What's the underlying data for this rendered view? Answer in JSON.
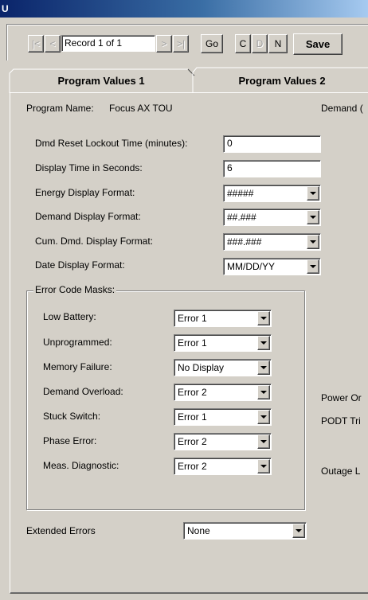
{
  "window": {
    "title_fragment": "U"
  },
  "toolbar": {
    "first_glyph": "|<",
    "prev_glyph": "<",
    "record_text": "Record 1 of 1",
    "next_glyph": ">",
    "last_glyph": ">|",
    "go_label": "Go",
    "c_label": "C",
    "d_label": "D",
    "n_label": "N",
    "save_label": "Save"
  },
  "tabs": [
    {
      "label": "Program Values 1",
      "active": false
    },
    {
      "label": "Program Values 2",
      "active": true
    }
  ],
  "program": {
    "name_label": "Program Name:",
    "name_value": "Focus AX TOU",
    "right_header": "Demand ("
  },
  "settings": {
    "dmd_reset_label": "Dmd Reset Lockout Time (minutes):",
    "dmd_reset_value": "0",
    "display_time_label": "Display Time in Seconds:",
    "display_time_value": "6",
    "energy_format_label": "Energy Display Format:",
    "energy_format_value": "#####",
    "demand_format_label": "Demand Display Format:",
    "demand_format_value": "##.###",
    "cum_dmd_format_label": "Cum. Dmd. Display Format:",
    "cum_dmd_format_value": "###.###",
    "date_format_label": "Date Display Format:",
    "date_format_value": "MM/DD/YY"
  },
  "error_masks": {
    "group_title": "Error Code Masks:",
    "items": [
      {
        "label": "Low Battery:",
        "value": "Error 1"
      },
      {
        "label": "Unprogrammed:",
        "value": "Error 1"
      },
      {
        "label": "Memory Failure:",
        "value": "No Display"
      },
      {
        "label": "Demand Overload:",
        "value": "Error 2"
      },
      {
        "label": "Stuck Switch:",
        "value": "Error 1"
      },
      {
        "label": "Phase Error:",
        "value": "Error 2"
      },
      {
        "label": "Meas. Diagnostic:",
        "value": "Error 2"
      }
    ]
  },
  "extended_errors": {
    "label": "Extended Errors",
    "value": "None"
  },
  "right_column": {
    "power_label": "Power Or",
    "podt_label": "PODT Tri",
    "outage_label": "Outage L"
  },
  "icons": {
    "first": "first-record-icon",
    "prev": "previous-record-icon",
    "next": "next-record-icon",
    "last": "last-record-icon",
    "dropdown": "chevron-down-icon"
  }
}
